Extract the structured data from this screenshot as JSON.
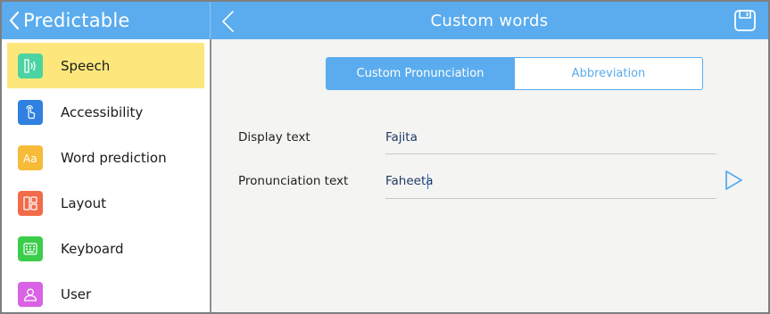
{
  "header": {
    "app_back_label": "Predictable",
    "title": "Custom words",
    "save_icon": "save-icon"
  },
  "sidebar": {
    "items": [
      {
        "label": "Speech",
        "icon": "speech-icon",
        "color": "#4cd3a2",
        "active": true
      },
      {
        "label": "Accessibility",
        "icon": "touch-hand-icon",
        "color": "#2f80e0",
        "active": false
      },
      {
        "label": "Word prediction",
        "icon": "text-aa-icon",
        "color": "#f7bb3a",
        "active": false
      },
      {
        "label": "Layout",
        "icon": "layout-icon",
        "color": "#f26b4a",
        "active": false
      },
      {
        "label": "Keyboard",
        "icon": "keyboard-icon",
        "color": "#3ccd4b",
        "active": false
      },
      {
        "label": "User",
        "icon": "user-icon",
        "color": "#d963e4",
        "active": false
      }
    ]
  },
  "main": {
    "tabs": [
      {
        "label": "Custom Pronunciation",
        "selected": true
      },
      {
        "label": "Abbreviation",
        "selected": false
      }
    ],
    "display_text": {
      "label": "Display text",
      "value": "Fajita"
    },
    "pronunciation_text": {
      "label": "Pronunciation text",
      "value": "Faheeta"
    },
    "play_icon": "play-icon"
  },
  "colors": {
    "accent": "#5aacee",
    "active_item": "#fde77d",
    "value_text": "#1f3a66"
  }
}
